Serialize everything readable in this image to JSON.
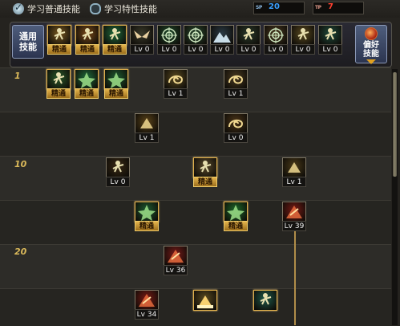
{
  "tabs": [
    {
      "label": "学习普通技能",
      "selected": true
    },
    {
      "label": "学习特性技能",
      "selected": false
    }
  ],
  "counters": [
    {
      "tag": "SP",
      "value": "20",
      "color": "#3aa0ff"
    },
    {
      "tag": "TP",
      "value": "7",
      "color": "#ff4030"
    }
  ],
  "buttons": {
    "common_skill": "通用\n技能",
    "prefer_skill": "偏好\n技能"
  },
  "level_labels": [
    "1",
    "10",
    "20"
  ],
  "common_skills": [
    {
      "icon": "sit-figure-icon",
      "caption": "精通",
      "style": "mastered",
      "tint": "#7a5a20"
    },
    {
      "icon": "dash-figure-icon",
      "caption": "精通",
      "style": "mastered",
      "tint": "#7a4a18"
    },
    {
      "icon": "run-figure-icon",
      "caption": "精通",
      "style": "mastered",
      "tint": "#1f6a3a"
    },
    {
      "icon": "wings-icon",
      "caption": "Lv 0",
      "style": "level",
      "tint": "#3a3a2a"
    },
    {
      "icon": "target-icon",
      "caption": "Lv 0",
      "style": "level",
      "tint": "#1e4a2a"
    },
    {
      "icon": "crosshair-icon",
      "caption": "Lv 0",
      "style": "level",
      "tint": "#2a4a30"
    },
    {
      "icon": "mountain-icon",
      "caption": "Lv 0",
      "style": "level",
      "tint": "#2a3a44"
    },
    {
      "icon": "kneel-figure-icon",
      "caption": "Lv 0",
      "style": "level",
      "tint": "#2a3a2a"
    },
    {
      "icon": "ring-icon",
      "caption": "Lv 0",
      "style": "level",
      "tint": "#4a3a20"
    },
    {
      "icon": "warrior-icon",
      "caption": "Lv 0",
      "style": "level",
      "tint": "#5a4a20"
    },
    {
      "icon": "spirit-figure-icon",
      "caption": "Lv 0",
      "style": "level",
      "tint": "#1e4a3a"
    }
  ],
  "tree_skills": [
    {
      "icon": "leaf-figure-icon",
      "caption": "精通",
      "style": "mastered",
      "tint": "#2a5a2a"
    },
    {
      "icon": "green-dash-icon",
      "caption": "精通",
      "style": "mastered",
      "tint": "#1e6a3a"
    },
    {
      "icon": "green-burst-icon",
      "caption": "精通",
      "style": "mastered",
      "tint": "#1e5a30"
    },
    {
      "icon": "swirl-kick-icon",
      "caption": "Lv 1",
      "style": "level",
      "tint": "#5a4a20"
    },
    {
      "icon": "spiral-icon",
      "caption": "Lv 1",
      "style": "level",
      "tint": "#4a3a20"
    },
    {
      "icon": "flame-slash-icon",
      "caption": "Lv 1",
      "style": "level",
      "tint": "#5a4218"
    },
    {
      "icon": "vortex-icon",
      "caption": "Lv 0",
      "style": "level",
      "tint": "#4a3418"
    },
    {
      "icon": "fire-figures-icon",
      "caption": "Lv 0",
      "style": "level",
      "tint": "#3a2a14"
    },
    {
      "icon": "trio-figures-icon",
      "caption": "精通",
      "style": "mastered",
      "tint": "#5a4a2a"
    },
    {
      "icon": "dragon-icon",
      "caption": "Lv 1",
      "style": "level",
      "tint": "#4a3a18"
    },
    {
      "icon": "green-star-icon",
      "caption": "精通",
      "style": "mastered",
      "tint": "#1e5a30"
    },
    {
      "icon": "green-lightning-icon",
      "caption": "精通",
      "style": "mastered",
      "tint": "#1e6a2a"
    },
    {
      "icon": "red-explosion-icon",
      "caption": "Lv 39",
      "style": "level",
      "tint": "#7a1a14"
    },
    {
      "icon": "red-spear-icon",
      "caption": "Lv 36",
      "style": "level",
      "tint": "#7a1a18"
    },
    {
      "icon": "red-flame-icon",
      "caption": "Lv 34",
      "style": "level",
      "tint": "#7a1a14"
    },
    {
      "icon": "golden-light-icon",
      "caption": "",
      "style": "blank",
      "tint": "#5a4a20"
    },
    {
      "icon": "teal-figure-icon",
      "caption": "",
      "style": "blank",
      "tint": "#1e5a4a"
    }
  ]
}
